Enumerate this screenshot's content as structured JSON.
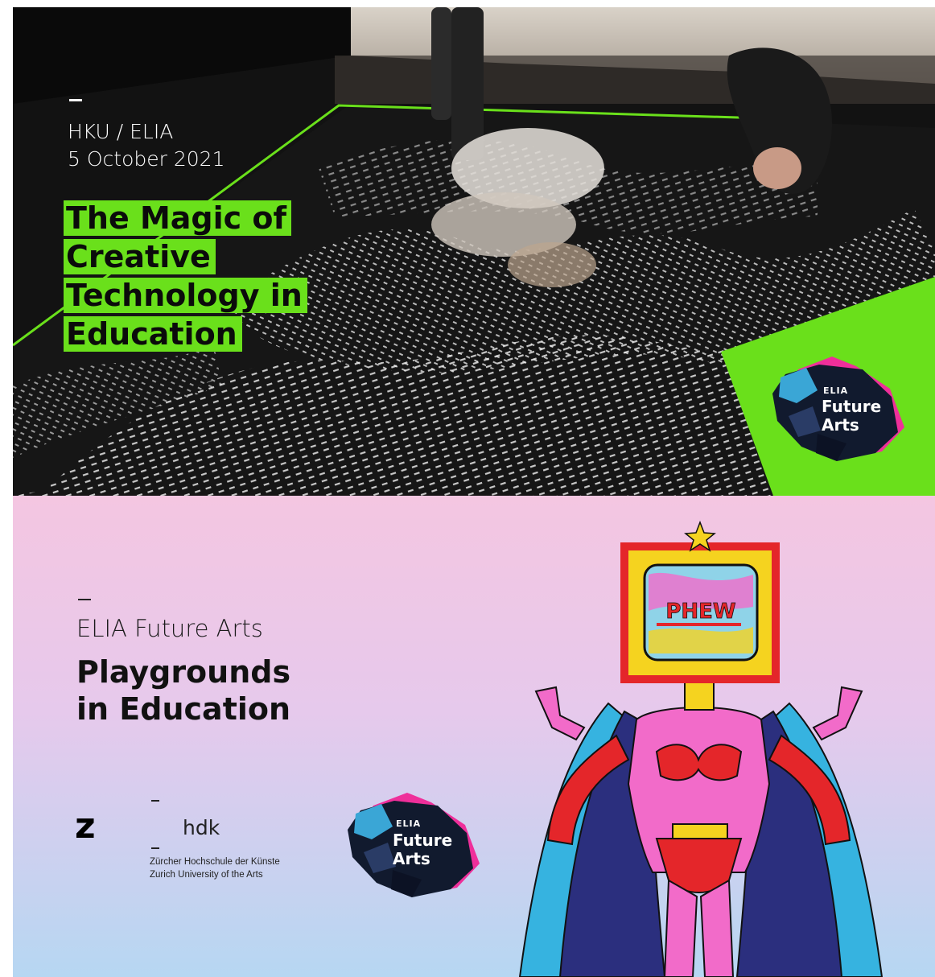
{
  "top_banner": {
    "organizer": "HKU / ELIA",
    "date": "5 October 2021",
    "title_lines": [
      "The Magic of",
      "Creative",
      "Technology in",
      "Education"
    ],
    "logo": {
      "small": "ELIA",
      "line1": "Future",
      "line2": "Arts"
    },
    "colors": {
      "accent_green": "#6ae01b",
      "dark_floor": "#1a1a18"
    }
  },
  "bottom_banner": {
    "subtitle": "ELIA Future Arts",
    "title_lines": [
      "Playgrounds",
      "in Education"
    ],
    "zhdk": {
      "mark": "z",
      "name": "hdk",
      "line1": "Zürcher Hochschule der Künste",
      "line2": "Zurich University of the Arts"
    },
    "logo": {
      "small": "ELIA",
      "line1": "Future",
      "line2": "Arts"
    },
    "illustration": {
      "tv_screen_text": "PHEW"
    },
    "colors": {
      "gradient_top": "#f4c6e1",
      "gradient_bottom": "#b6d7f2",
      "hero_pink": "#f26bc9",
      "hero_red": "#e4262a"
    }
  }
}
